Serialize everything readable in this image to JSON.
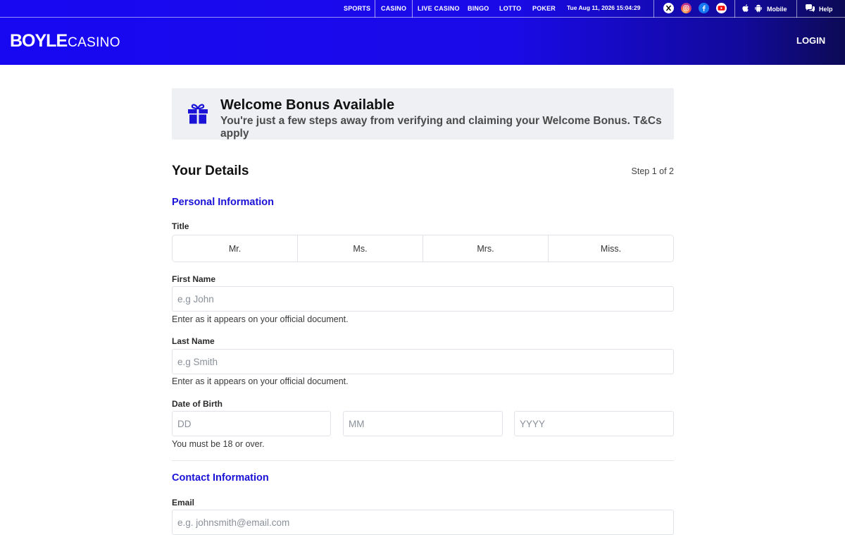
{
  "topbar": {
    "nav": [
      {
        "label": "SPORTS"
      },
      {
        "label": "CASINO"
      },
      {
        "label": "LIVE CASINO"
      },
      {
        "label": "BINGO"
      },
      {
        "label": "LOTTO"
      },
      {
        "label": "POKER"
      }
    ],
    "datetime": "Tue Aug 11, 2026 15:04:29",
    "social_icons": [
      "x-icon",
      "instagram-icon",
      "facebook-icon",
      "youtube-icon"
    ],
    "mobile_label": "Mobile",
    "help_label": "Help"
  },
  "header": {
    "logo_main": "BOYLE",
    "logo_sub": "CASINO",
    "login_label": "LOGIN",
    "colors": {
      "header_start": "#1808f2",
      "header_end": "#0c0a55"
    }
  },
  "bonus": {
    "title": "Welcome Bonus Available",
    "subtitle": "You're just a few steps away from verifying and claiming your Welcome Bonus. T&Cs apply",
    "icon": "gift-icon"
  },
  "form": {
    "heading": "Your Details",
    "step": "Step 1 of 2",
    "personal_section": "Personal Information",
    "title_label": "Title",
    "title_options": [
      {
        "label": "Mr."
      },
      {
        "label": "Ms."
      },
      {
        "label": "Mrs."
      },
      {
        "label": "Miss."
      }
    ],
    "first_name": {
      "label": "First Name",
      "placeholder": "e.g John",
      "value": "",
      "hint": "Enter as it appears on your official document."
    },
    "last_name": {
      "label": "Last Name",
      "placeholder": "e.g Smith",
      "value": "",
      "hint": "Enter as it appears on your official document."
    },
    "dob": {
      "label": "Date of Birth",
      "day_placeholder": "DD",
      "month_placeholder": "MM",
      "year_placeholder": "YYYY",
      "hint": "You must be 18 or over."
    },
    "contact_section": "Contact Information",
    "email": {
      "label": "Email",
      "placeholder": "e.g. johnsmith@email.com",
      "value": ""
    },
    "accent_color": "#1a12d6"
  }
}
